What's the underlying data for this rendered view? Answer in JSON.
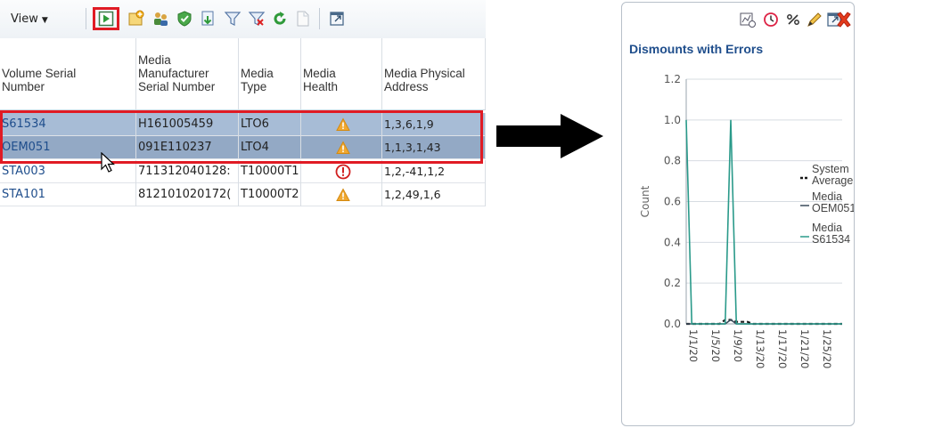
{
  "toolbar": {
    "view_label": "View",
    "icons": [
      "detach-icon",
      "add-icon",
      "users-icon",
      "check-shield-icon",
      "export-icon",
      "filter-icon",
      "clear-filter-icon",
      "refresh-icon",
      "document-icon",
      "maximize-icon"
    ]
  },
  "table": {
    "columns": [
      "Volume Serial\nNumber",
      "Media\nManufacturer\nSerial Number",
      "Media\nType",
      "Media\nHealth",
      "Media Physical\nAddress"
    ],
    "rows": [
      {
        "serial": "S61534",
        "manufacturer_serial": "H161005459",
        "type": "LTO6",
        "health": "warning",
        "address": "1,3,6,1,9",
        "selected": true
      },
      {
        "serial": "OEM051",
        "manufacturer_serial": "091E110237",
        "type": "LTO4",
        "health": "warning",
        "address": "1,1,3,1,43",
        "selected": true
      },
      {
        "serial": "STA003",
        "manufacturer_serial": "711312040128:",
        "type": "T10000T1",
        "health": "error",
        "address": "1,2,-41,1,2",
        "selected": false
      },
      {
        "serial": "STA101",
        "manufacturer_serial": "812101020172(",
        "type": "T10000T2",
        "health": "warning",
        "address": "1,2,49,1,6",
        "selected": false
      }
    ]
  },
  "chart_panel": {
    "title": "Dismounts with Errors",
    "toolbar_icons": [
      "chart-type-icon",
      "clock-icon",
      "percent-icon",
      "edit-icon",
      "maximize-icon",
      "close-icon"
    ]
  },
  "chart_data": {
    "type": "line",
    "title": "Dismounts with Errors",
    "xlabel": "",
    "ylabel": "Count",
    "ylim": [
      0,
      1.2
    ],
    "yticks": [
      "0.0",
      "0.2",
      "0.4",
      "0.6",
      "0.8",
      "1.0",
      "1.2"
    ],
    "x_categories": [
      "1/1/20",
      "1/5/20",
      "1/9/20",
      "1/13/20",
      "1/17/20",
      "1/21/20",
      "1/25/20"
    ],
    "x": [
      "1/1/20",
      "1/2/20",
      "1/3/20",
      "1/4/20",
      "1/5/20",
      "1/6/20",
      "1/7/20",
      "1/8/20",
      "1/9/20",
      "1/10/20",
      "1/11/20",
      "1/12/20",
      "1/13/20",
      "1/14/20",
      "1/15/20",
      "1/16/20",
      "1/17/20",
      "1/18/20",
      "1/19/20",
      "1/20/20",
      "1/21/20",
      "1/22/20",
      "1/23/20",
      "1/24/20",
      "1/25/20",
      "1/26/20",
      "1/27/20",
      "1/28/20",
      "1/29/20"
    ],
    "series": [
      {
        "name": "System Average",
        "style": "dashed",
        "color": "#1a1a1a",
        "values": [
          0,
          0,
          0,
          0,
          0,
          0,
          0,
          0.02,
          0.02,
          0.01,
          0.01,
          0.01,
          0,
          0,
          0,
          0,
          0,
          0,
          0,
          0,
          0,
          0,
          0,
          0,
          0,
          0,
          0,
          0,
          0
        ]
      },
      {
        "name": "Media OEM051",
        "style": "solid",
        "color": "#3a4a5a",
        "values": [
          0,
          0,
          0,
          0,
          0,
          0,
          0,
          0,
          0.02,
          0,
          0,
          0,
          0,
          0,
          0,
          0,
          0,
          0,
          0,
          0,
          0,
          0,
          0,
          0,
          0,
          0,
          0,
          0,
          0
        ]
      },
      {
        "name": "Media S61534",
        "style": "solid",
        "color": "#2a9a8a",
        "values": [
          1.0,
          0,
          0,
          0,
          0,
          0,
          0,
          0,
          1.0,
          0,
          0,
          0,
          0,
          0,
          0,
          0,
          0,
          0,
          0,
          0,
          0,
          0,
          0,
          0,
          0,
          0,
          0,
          0,
          0
        ]
      }
    ],
    "legend": [
      {
        "label": "System\nAverage",
        "style": "dashed"
      },
      {
        "label": "Media\nOEM051",
        "style": "solid"
      },
      {
        "label": "Media\nS61534",
        "style": "solid"
      }
    ],
    "legend_position": "right",
    "grid": true
  },
  "colors": {
    "highlight": "#e01b24",
    "link": "#1f4e8c",
    "selected_row": "#a7bcd6",
    "title": "#1f4e8c"
  }
}
